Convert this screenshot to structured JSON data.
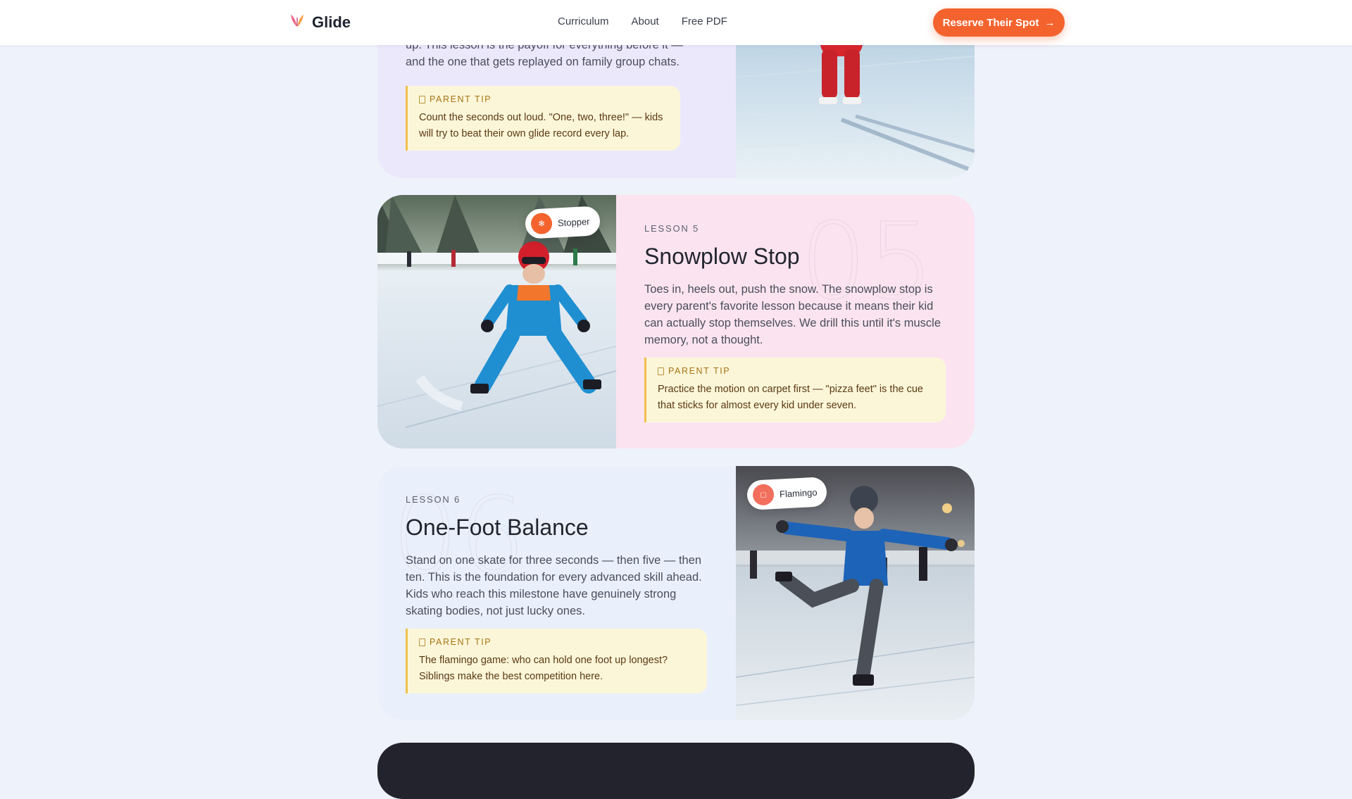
{
  "header": {
    "brand": "Glide",
    "nav": [
      "Curriculum",
      "About",
      "Free PDF"
    ],
    "cta_label": "Reserve Their Spot",
    "cta_arrow": "→",
    "accent_color": "#f4632e"
  },
  "lessons": [
    {
      "description_fragment_1": "up. This lesson is the payoff for everything before it —",
      "description_fragment_2": "and the one that gets replayed on family group chats.",
      "tip_label": "PARENT TIP",
      "tip_text": "Count the seconds out loud. \"One, two, three!\" — kids will try to beat their own glide record every lap."
    },
    {
      "number_label": "LESSON 5",
      "watermark": "05",
      "title": "Snowplow Stop",
      "description": "Toes in, heels out, push the snow. The snowplow stop is every parent's favorite lesson because it means their kid can actually stop themselves. We drill this until it's muscle memory, not a thought.",
      "tip_label": "PARENT TIP",
      "tip_text": "Practice the motion on carpet first — \"pizza feet\" is the cue that sticks for almost every kid under seven.",
      "badge_label": "Stopper",
      "badge_icon": "snowflake-icon",
      "badge_icon_glyph": "❄",
      "badge_color": "#f4632e"
    },
    {
      "number_label": "LESSON 6",
      "watermark": "06",
      "title": "One-Foot Balance",
      "description": "Stand on one skate for three seconds — then five — then ten. This is the foundation for every advanced skill ahead. Kids who reach this milestone have genuinely strong skating bodies, not just lucky ones.",
      "tip_label": "PARENT TIP",
      "tip_text": "The flamingo game: who can hold one foot up longest? Siblings make the best competition here.",
      "badge_label": "Flamingo",
      "badge_icon": "flamingo-icon",
      "badge_icon_glyph": "□",
      "badge_color": "#f26f5d"
    }
  ]
}
